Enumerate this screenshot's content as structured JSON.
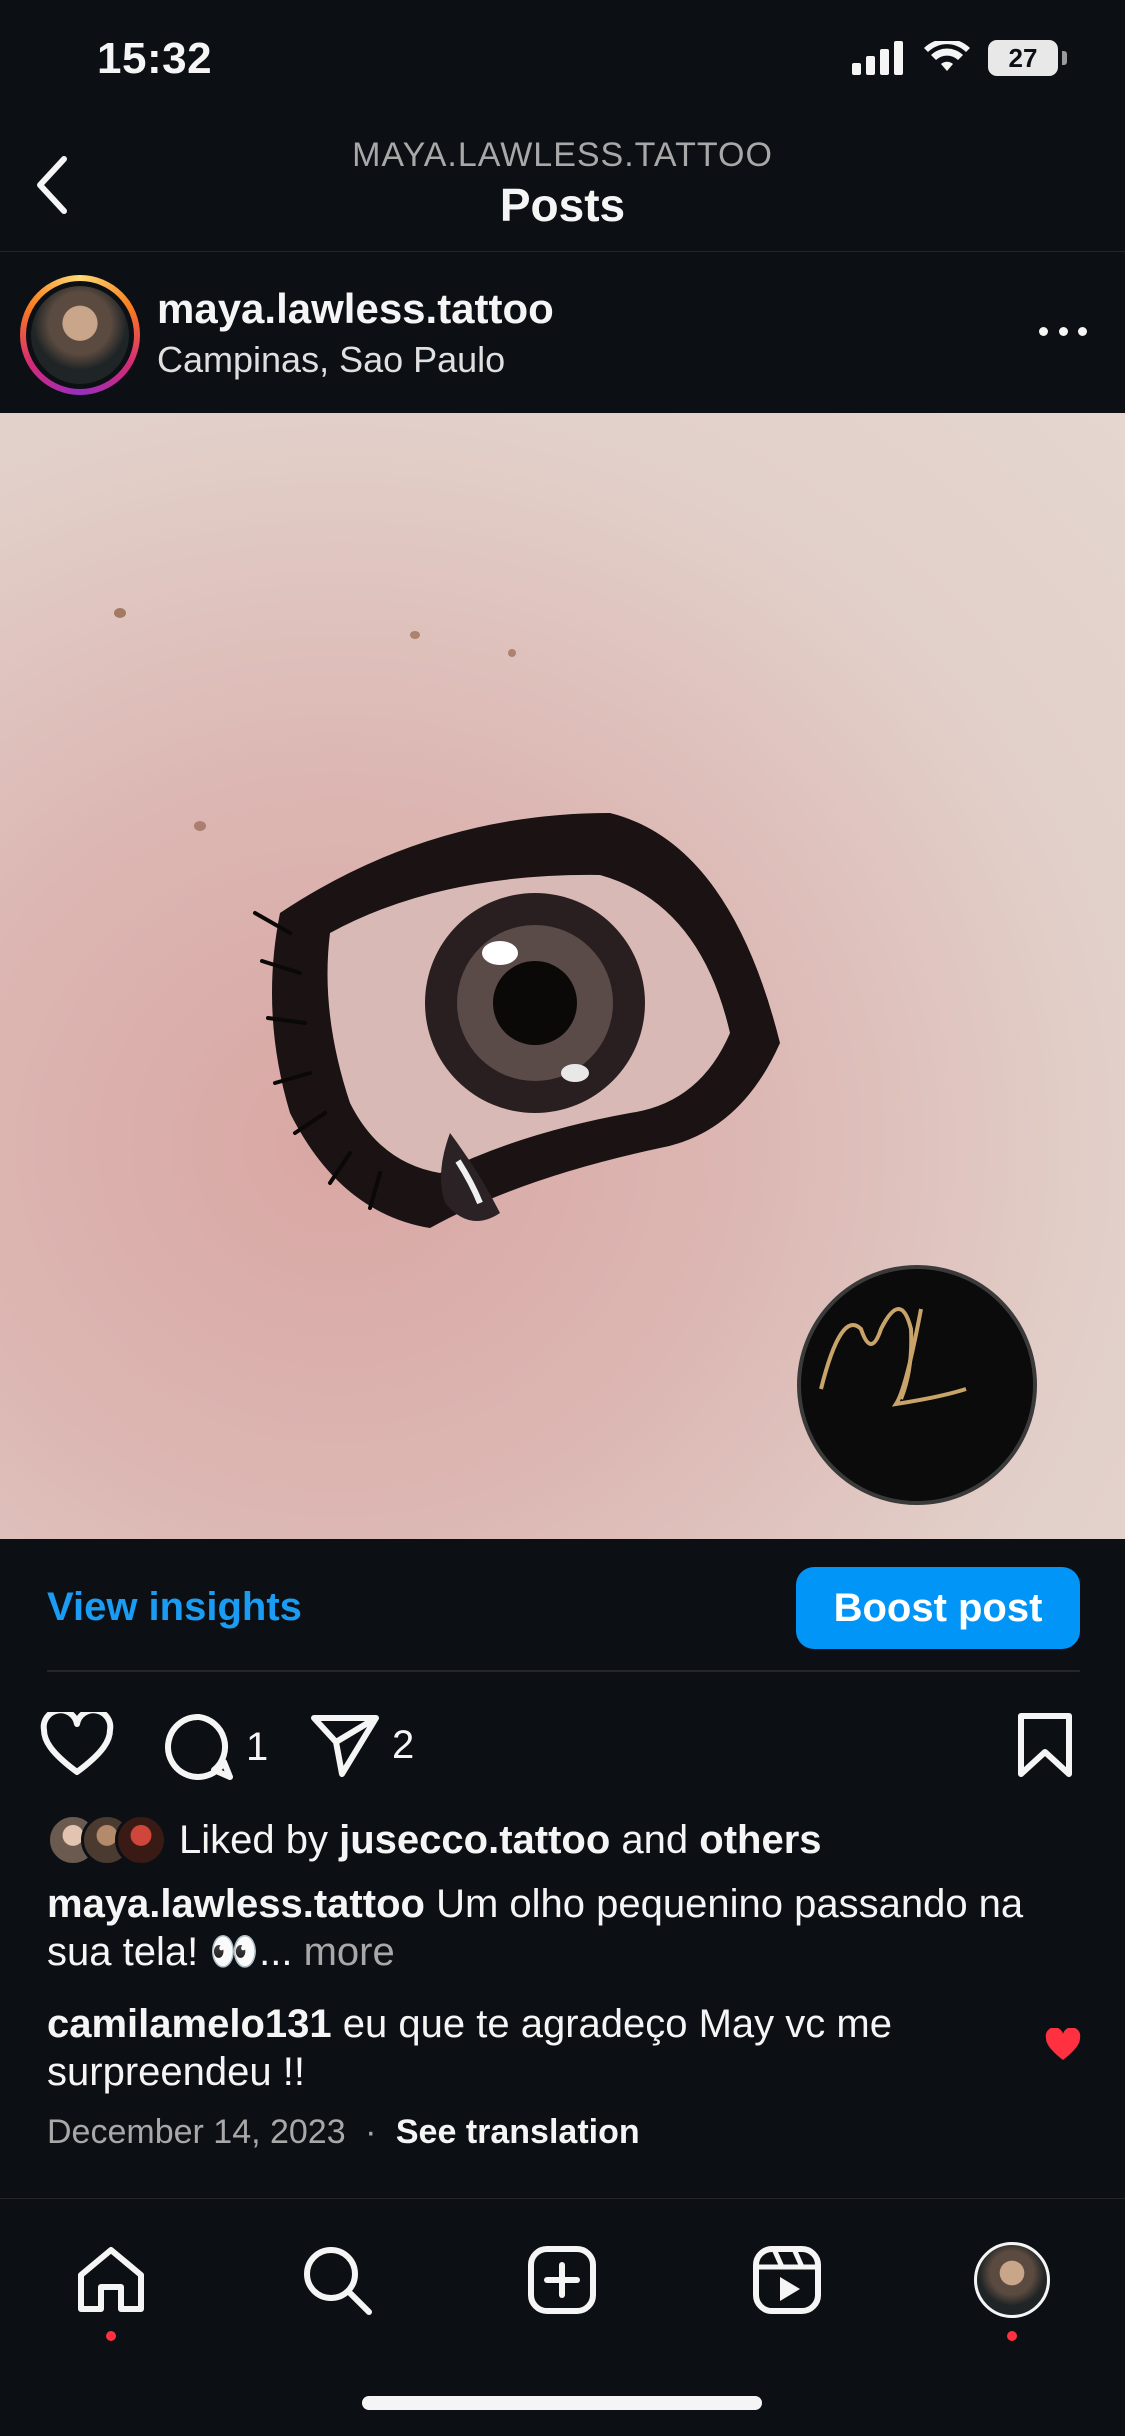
{
  "status_bar": {
    "time": "15:32",
    "battery": "27"
  },
  "header": {
    "account": "MAYA.LAWLESS.TATTOO",
    "title": "Posts"
  },
  "post": {
    "username": "maya.lawless.tattoo",
    "location": "Campinas, Sao Paulo",
    "image_description_icon": "eye-tattoo-image",
    "watermark_text": "ML"
  },
  "insights": {
    "view_label": "View insights",
    "boost_label": "Boost post"
  },
  "actions": {
    "comments_count": "1",
    "shares_count": "2"
  },
  "likes": {
    "prefix": "Liked by",
    "user": "jusecco.tattoo",
    "conj": "and",
    "others": "others"
  },
  "caption": {
    "username": "maya.lawless.tattoo",
    "text": "Um olho pequenino passando na sua tela! 👀...",
    "more": "more"
  },
  "comment": {
    "username": "camilamelo131",
    "text": "eu que te agradeço May vc me surpreendeu !!"
  },
  "meta": {
    "date": "December 14, 2023",
    "separator": "·",
    "translation": "See translation"
  },
  "colors": {
    "background": "#0c1014",
    "accent": "#0095f6",
    "link": "#1a9cf4",
    "heart": "#ff3040",
    "notification_dot": "#ff3040"
  },
  "nav": [
    "home-icon",
    "search-icon",
    "create-icon",
    "reels-icon",
    "profile-avatar"
  ]
}
